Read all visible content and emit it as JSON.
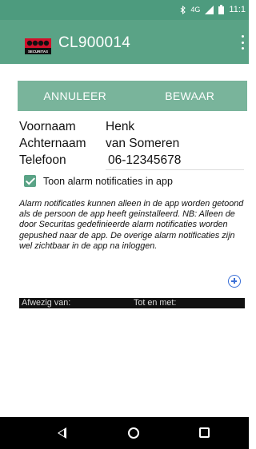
{
  "status_bar": {
    "network": "4G",
    "time": "11:1"
  },
  "app_bar": {
    "logo_text": "SECURITAS",
    "title": "CL900014"
  },
  "actions": {
    "cancel_label": "ANNULEER",
    "save_label": "BEWAAR"
  },
  "form": {
    "first_name_label": "Voornaam",
    "first_name_value": "Henk",
    "last_name_label": "Achternaam",
    "last_name_value": "van Someren",
    "phone_label": "Telefoon",
    "phone_value": "06-12345678"
  },
  "checkbox": {
    "label": "Toon alarm notificaties in app",
    "checked": true
  },
  "info_text": "Alarm notificaties kunnen alleen in de app worden getoond als de persoon de app heeft geinstalleerd. NB: Alleen de door Securitas gedefinieerde alarm notificaties worden gepushed naar de app. De overige alarm notificaties zijn wel zichtbaar in de app na inloggen.",
  "absence_table": {
    "col_from": "Afwezig van:",
    "col_to": "Tot en met:"
  },
  "colors": {
    "primary": "#5aa386",
    "button_bar": "#79b49b",
    "add_icon": "#3a6fd6"
  }
}
